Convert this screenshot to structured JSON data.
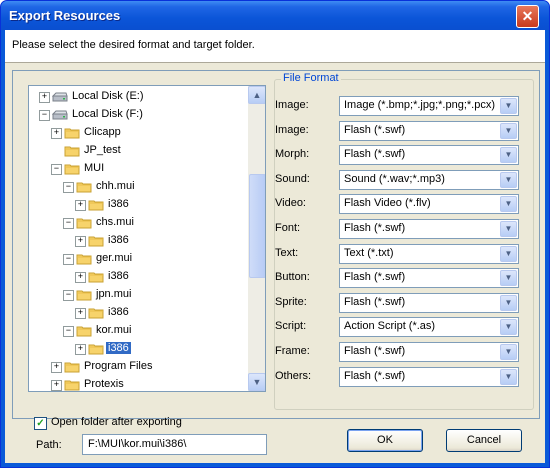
{
  "window": {
    "title": "Export Resources",
    "close_glyph": "✕"
  },
  "header": {
    "instruction": "Please select the desired format and target folder."
  },
  "tree": {
    "items": [
      {
        "label": "Local Disk (E:)",
        "icon": "drive-icon",
        "expander": "+",
        "selected": false
      },
      {
        "label": "Local Disk (F:)",
        "icon": "drive-icon",
        "expander": "−",
        "selected": false
      },
      {
        "label": "Clicapp",
        "icon": "folder-icon",
        "expander": "+",
        "selected": false
      },
      {
        "label": "JP_test",
        "icon": "folder-icon",
        "expander": "",
        "selected": false
      },
      {
        "label": "MUI",
        "icon": "folder-icon",
        "expander": "−",
        "selected": false
      },
      {
        "label": "chh.mui",
        "icon": "folder-icon",
        "expander": "−",
        "selected": false
      },
      {
        "label": "i386",
        "icon": "folder-icon",
        "expander": "+",
        "selected": false
      },
      {
        "label": "chs.mui",
        "icon": "folder-icon",
        "expander": "−",
        "selected": false
      },
      {
        "label": "i386",
        "icon": "folder-icon",
        "expander": "+",
        "selected": false
      },
      {
        "label": "ger.mui",
        "icon": "folder-icon",
        "expander": "−",
        "selected": false
      },
      {
        "label": "i386",
        "icon": "folder-icon",
        "expander": "+",
        "selected": false
      },
      {
        "label": "jpn.mui",
        "icon": "folder-icon",
        "expander": "−",
        "selected": false
      },
      {
        "label": "i386",
        "icon": "folder-icon",
        "expander": "+",
        "selected": false
      },
      {
        "label": "kor.mui",
        "icon": "folder-icon",
        "expander": "−",
        "selected": false
      },
      {
        "label": "i386",
        "icon": "folder-icon",
        "expander": "+",
        "selected": true
      },
      {
        "label": "Program Files",
        "icon": "folder-icon",
        "expander": "+",
        "selected": false
      },
      {
        "label": "Protexis",
        "icon": "folder-icon",
        "expander": "+",
        "selected": false
      }
    ],
    "scroll_up_glyph": "▲",
    "scroll_down_glyph": "▼"
  },
  "file_format": {
    "legend": "File Format",
    "rows": [
      {
        "label": "Image:",
        "value": "Image (*.bmp;*.jpg;*.png;*.pcx)"
      },
      {
        "label": "Image:",
        "value": "Flash (*.swf)"
      },
      {
        "label": "Morph:",
        "value": "Flash (*.swf)"
      },
      {
        "label": "Sound:",
        "value": "Sound (*.wav;*.mp3)"
      },
      {
        "label": "Video:",
        "value": "Flash Video (*.flv)"
      },
      {
        "label": "Font:",
        "value": "Flash (*.swf)"
      },
      {
        "label": "Text:",
        "value": "Text (*.txt)"
      },
      {
        "label": "Button:",
        "value": "Flash (*.swf)"
      },
      {
        "label": "Sprite:",
        "value": "Flash (*.swf)"
      },
      {
        "label": "Script:",
        "value": "Action Script (*.as)"
      },
      {
        "label": "Frame:",
        "value": "Flash (*.swf)"
      },
      {
        "label": "Others:",
        "value": "Flash (*.swf)"
      }
    ],
    "dropdown_glyph": "▼"
  },
  "options": {
    "open_folder_label": "Open folder after exporting",
    "open_folder_checked": true,
    "check_glyph": "✓"
  },
  "path": {
    "label": "Path:",
    "value": "F:\\MUI\\kor.mui\\i386\\"
  },
  "buttons": {
    "ok": "OK",
    "cancel": "Cancel"
  },
  "colors": {
    "title_bar": "#0a5ad8",
    "selection": "#316ac5",
    "legend_text": "#0046d5",
    "dialog_bg": "#ece9d8"
  }
}
